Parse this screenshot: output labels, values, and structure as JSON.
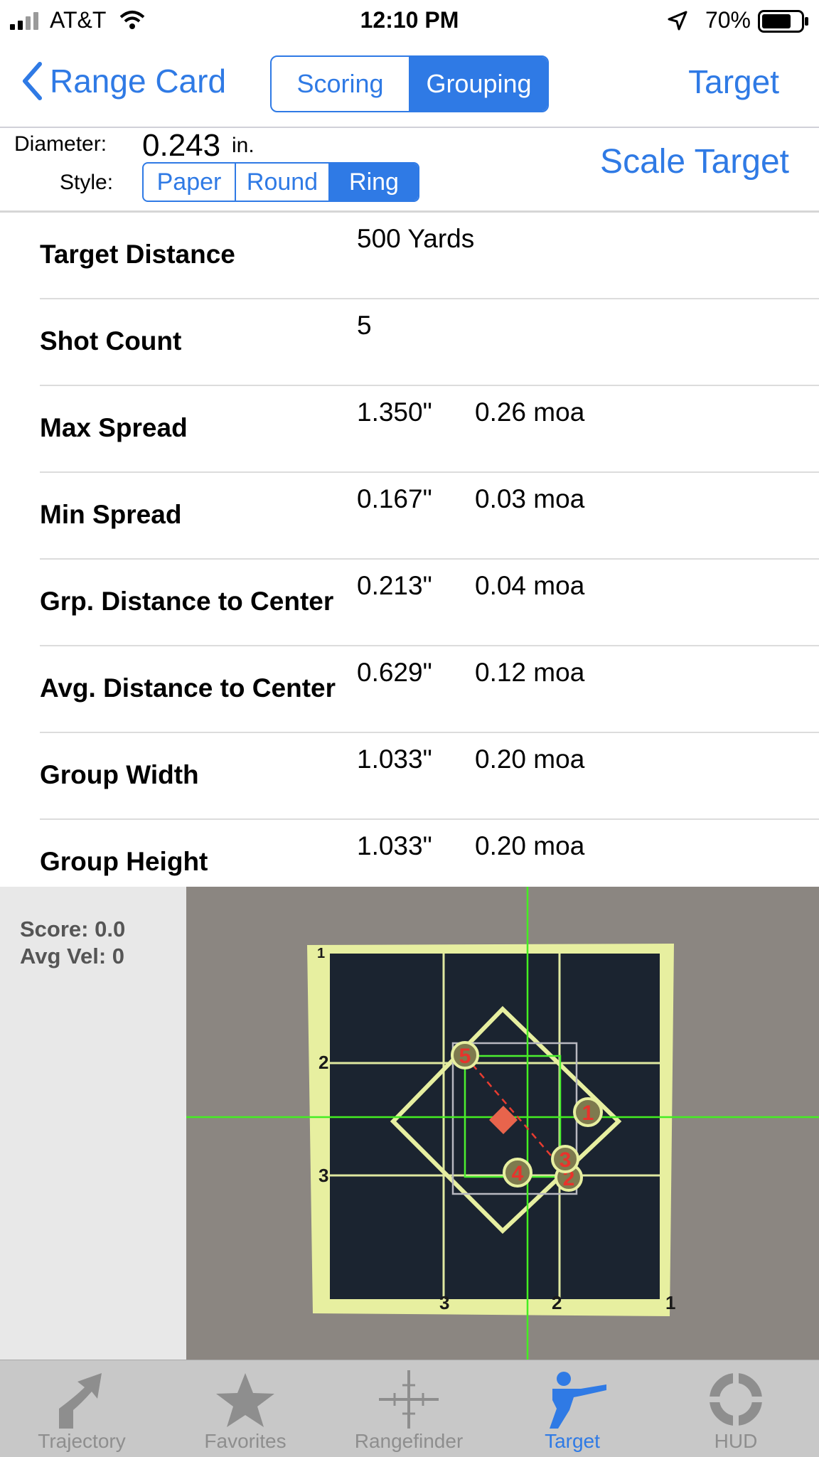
{
  "status_bar": {
    "carrier": "AT&T",
    "time": "12:10 PM",
    "battery": "70%"
  },
  "nav": {
    "back_label": "Range Card",
    "segments": [
      "Scoring",
      "Grouping"
    ],
    "selected_segment": "Grouping",
    "right_label": "Target"
  },
  "diameter": {
    "label": "Diameter:",
    "value": "0.243",
    "unit": "in.",
    "style_label": "Style:",
    "styles": [
      "Paper",
      "Round",
      "Ring"
    ],
    "selected_style": "Ring",
    "scale_button": "Scale Target"
  },
  "stats": [
    {
      "name": "Target Distance",
      "v1": "500 Yards",
      "v2": ""
    },
    {
      "name": "Shot Count",
      "v1": "5",
      "v2": ""
    },
    {
      "name": "Max Spread",
      "v1": "1.350\"",
      "v2": "0.26 moa"
    },
    {
      "name": "Min Spread",
      "v1": "0.167\"",
      "v2": "0.03 moa"
    },
    {
      "name": "Grp. Distance to Center",
      "v1": "0.213\"",
      "v2": "0.04 moa"
    },
    {
      "name": "Avg. Distance to Center",
      "v1": "0.629\"",
      "v2": "0.12 moa"
    },
    {
      "name": "Group Width",
      "v1": "1.033\"",
      "v2": "0.20 moa"
    },
    {
      "name": "Group Height",
      "v1": "1.033\"",
      "v2": "0.20 moa"
    }
  ],
  "target_view": {
    "score": "Score: 0.0",
    "avg_vel": "Avg Vel: 0",
    "grid_labels": {
      "tl": "1",
      "left_top": "2",
      "left_bottom": "3",
      "bottom_left": "3",
      "bottom_mid": "2",
      "bottom_right": "1"
    },
    "shots": [
      "1",
      "2",
      "3",
      "4",
      "5"
    ]
  },
  "tabs": [
    {
      "label": "Trajectory",
      "icon": "trajectory-icon"
    },
    {
      "label": "Favorites",
      "icon": "star-icon"
    },
    {
      "label": "Rangefinder",
      "icon": "crosshair-icon"
    },
    {
      "label": "Target",
      "icon": "shooter-icon"
    },
    {
      "label": "HUD",
      "icon": "hud-icon"
    }
  ],
  "active_tab": "Target",
  "colors": {
    "accent": "#2f7ae5",
    "target_yellow": "#e8f0a0",
    "grid_green": "#44ee22"
  }
}
